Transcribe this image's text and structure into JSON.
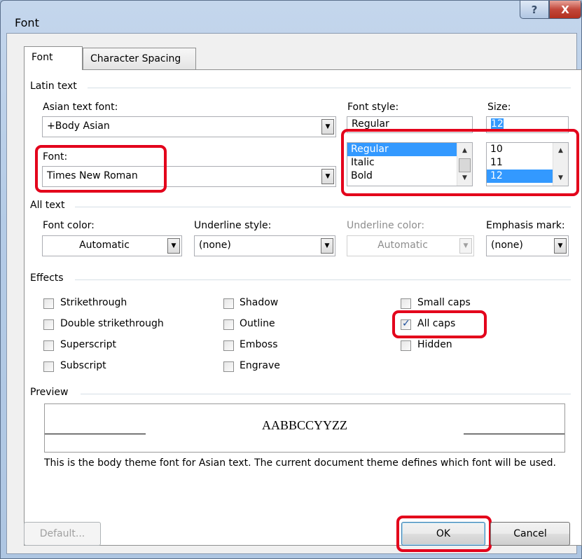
{
  "window": {
    "title": "Font",
    "help_glyph": "?",
    "close_glyph": "X"
  },
  "tabs": [
    {
      "label": "Font",
      "active": true
    },
    {
      "label": "Character Spacing",
      "active": false
    }
  ],
  "latin": {
    "group_label": "Latin text",
    "asian_font_label": "Asian text font:",
    "asian_font_value": "+Body Asian",
    "font_label": "Font:",
    "font_value": "Times New Roman",
    "style_label": "Font style:",
    "style_value": "Regular",
    "style_options": [
      "Regular",
      "Italic",
      "Bold"
    ],
    "size_label": "Size:",
    "size_value": "12",
    "size_options": [
      "10",
      "11",
      "12"
    ]
  },
  "all_text": {
    "group_label": "All text",
    "font_color_label": "Font color:",
    "font_color_value": "Automatic",
    "underline_style_label": "Underline style:",
    "underline_style_value": "(none)",
    "underline_color_label": "Underline color:",
    "underline_color_value": "Automatic",
    "emphasis_label": "Emphasis mark:",
    "emphasis_value": "(none)"
  },
  "effects": {
    "group_label": "Effects",
    "items": [
      {
        "label": "Strikethrough",
        "checked": false
      },
      {
        "label": "Double strikethrough",
        "checked": false
      },
      {
        "label": "Superscript",
        "checked": false
      },
      {
        "label": "Subscript",
        "checked": false
      },
      {
        "label": "Shadow",
        "checked": false
      },
      {
        "label": "Outline",
        "checked": false
      },
      {
        "label": "Emboss",
        "checked": false
      },
      {
        "label": "Engrave",
        "checked": false
      },
      {
        "label": "Small caps",
        "checked": false
      },
      {
        "label": "All caps",
        "checked": true
      },
      {
        "label": "Hidden",
        "checked": false
      }
    ]
  },
  "preview": {
    "group_label": "Preview",
    "sample": "AABBCCYYZZ",
    "note": "This is the body theme font for Asian text. The current document theme defines which font will be used."
  },
  "buttons": {
    "default": "Default...",
    "ok": "OK",
    "cancel": "Cancel"
  },
  "colors": {
    "highlight": "#e3001b",
    "selection": "#3399ff"
  }
}
